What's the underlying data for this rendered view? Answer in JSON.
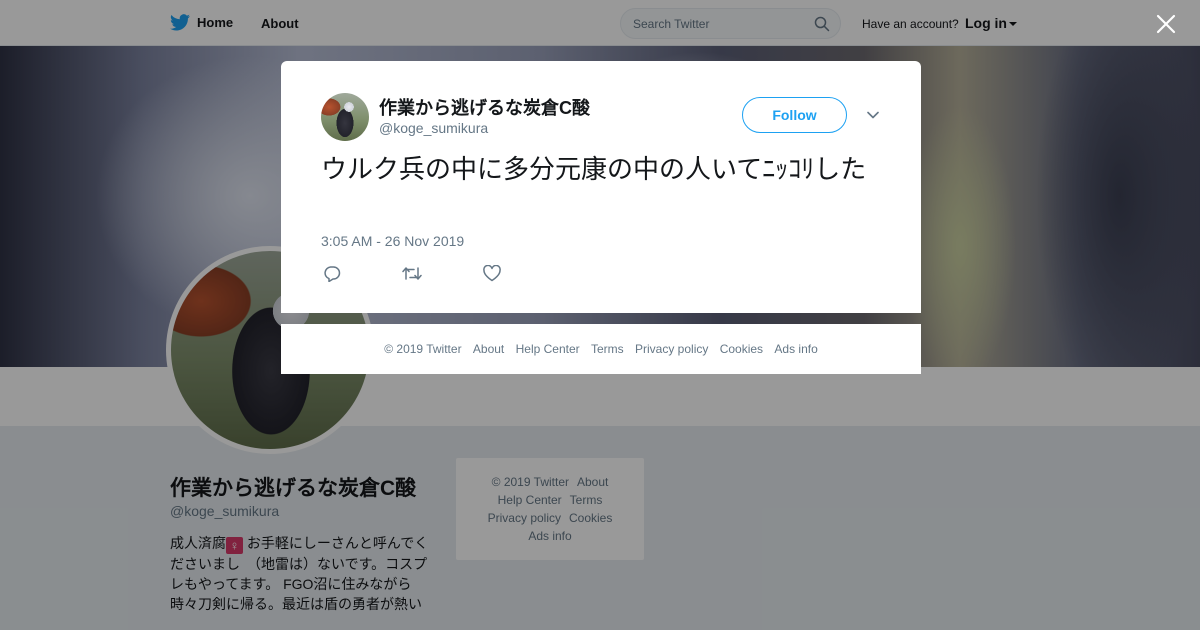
{
  "nav": {
    "home": "Home",
    "about": "About",
    "search_placeholder": "Search Twitter",
    "have_account": "Have an account?",
    "login": "Log in"
  },
  "profile": {
    "name": "作業から逃げるな炭倉C酸",
    "handle": "@koge_sumikura",
    "bio_before_icon": "成人済腐",
    "bio_icon": "♀",
    "bio_after_icon": " お手軽にしーさんと呼んでくださいまし　（地雷は）ないです。コスプレもやってます。 FGO沼に住みながら時々刀剣に帰る。最近は盾の勇者が熱い"
  },
  "side_footer": {
    "items": [
      "© 2019 Twitter",
      "About",
      "Help Center",
      "Terms",
      "Privacy policy",
      "Cookies",
      "Ads info"
    ]
  },
  "tweet": {
    "name": "作業から逃げるな炭倉C酸",
    "handle": "@koge_sumikura",
    "follow": "Follow",
    "text": "ウルク兵の中に多分元康の中の人いてﾆｯｺﾘした",
    "timestamp": "3:05 AM - 26 Nov 2019"
  },
  "modal_footer": {
    "items": [
      "© 2019 Twitter",
      "About",
      "Help Center",
      "Terms",
      "Privacy policy",
      "Cookies",
      "Ads info"
    ]
  },
  "icons": {
    "brand": "twitter-bird-icon",
    "search": "search-icon",
    "close": "close-icon",
    "caret": "caret-down-icon",
    "more": "chevron-down-icon",
    "reply": "reply-icon",
    "retweet": "retweet-icon",
    "like": "heart-icon"
  },
  "colors": {
    "brand": "#1da1f2",
    "text": "#14171a",
    "muted": "#657786",
    "background": "#e6ecf0"
  }
}
